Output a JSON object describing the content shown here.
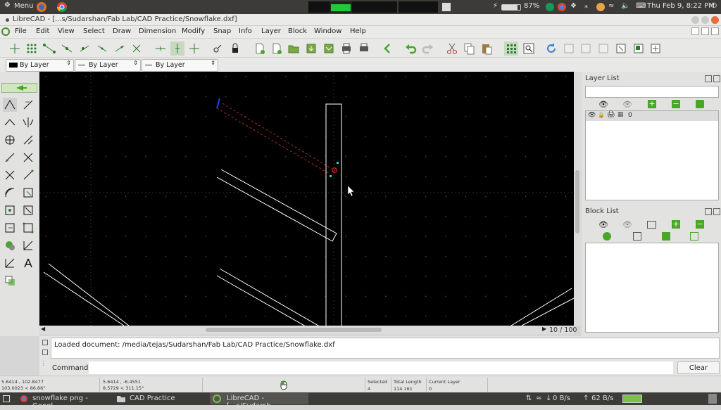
{
  "system_panel": {
    "menu_label": "Menu",
    "battery": "87%",
    "datetime": "Thu Feb  9,  8:22 PM"
  },
  "window": {
    "title": "LibreCAD - [...s/Sudarshan/Fab Lab/CAD Practice/Snowflake.dxf]"
  },
  "menu": [
    "File",
    "Edit",
    "View",
    "Select",
    "Draw",
    "Dimension",
    "Modify",
    "Snap",
    "Info",
    "Layer",
    "Block",
    "Window",
    "Help"
  ],
  "pen_toolbar": {
    "color": "By Layer",
    "width": "By Layer",
    "linetype": "By Layer"
  },
  "canvas": {
    "background": "#000000",
    "grid_info": "10 / 100"
  },
  "layer_list": {
    "title": "Layer List",
    "layers": [
      {
        "name": "0"
      }
    ]
  },
  "block_list": {
    "title": "Block List"
  },
  "console": {
    "message": "Loaded document: /media/tejas/Sudarshan/Fab Lab/CAD Practice/Snowflake.dxf",
    "command_label": "Command:",
    "clear_button": "Clear"
  },
  "status": {
    "abs_coord": "5.6414 , 102.8477",
    "abs_polar": "103.0023 < 86.86°",
    "rel_coord": "5.6414 , -6.4551",
    "rel_polar": "8.5729 < 311.15°",
    "selected_label": "Selected",
    "selected_value": "4",
    "total_length_label": "Total Length",
    "total_length_value": "114.161",
    "current_layer_label": "Current Layer",
    "current_layer_value": "0"
  },
  "taskbar": {
    "tasks": [
      "snowflake png - Googl...",
      "CAD Practice",
      "LibreCAD - [...s/Sudarsh..."
    ],
    "download": "0 B/s",
    "upload": "62 B/s"
  }
}
